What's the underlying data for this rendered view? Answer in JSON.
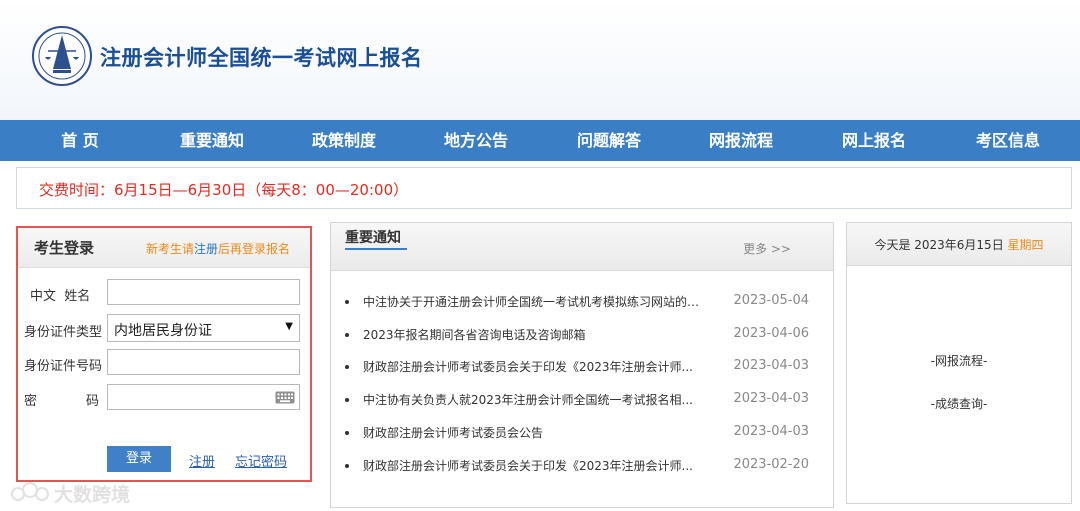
{
  "header": {
    "site_title": "注册会计师全国统一考试网上报名"
  },
  "nav": {
    "items": [
      "首 页",
      "重要通知",
      "政策制度",
      "地方公告",
      "问题解答",
      "网报流程",
      "网上报名",
      "考区信息"
    ]
  },
  "notice": {
    "text": "交费时间：6月15日—6月30日（每天8：00—20:00）"
  },
  "login": {
    "title": "考生登录",
    "hint_before": "新考生请",
    "hint_link": "注册",
    "hint_after": "后再登录报名",
    "name_label": "中文  姓名",
    "id_type_label": "身份证件类型",
    "id_type_value": "内地居民身份证",
    "id_number_label": "身份证件号码",
    "password_label_a": "密",
    "password_label_b": "码",
    "name_value": "",
    "id_number_value": "",
    "password_value": "",
    "login_button": "登录",
    "register_link": "注册",
    "forgot_link": "忘记密码"
  },
  "news": {
    "title": "重要通知",
    "more": "更多 >>",
    "items": [
      {
        "text": "中注协关于开通注册会计师全国统一考试机考模拟练习网站的公...",
        "date": "2023-05-04"
      },
      {
        "text": "2023年报名期间各省咨询电话及咨询邮箱",
        "date": "2023-04-06"
      },
      {
        "text": "财政部注册会计师考试委员会关于印发《2023年注册会计师...",
        "date": "2023-04-03"
      },
      {
        "text": "中注协有关负责人就2023年注册会计师全国统一考试报名相...",
        "date": "2023-04-03"
      },
      {
        "text": "财政部注册会计师考试委员会公告",
        "date": "2023-04-03"
      },
      {
        "text": "财政部注册会计师考试委员会关于印发《2023年注册会计师...",
        "date": "2023-02-20"
      }
    ]
  },
  "side": {
    "today_prefix": "今天是 2023年6月15日",
    "weekday": "星期四",
    "links": [
      "-网报流程-",
      "-成绩查询-"
    ]
  },
  "watermark": {
    "text": "大数跨境"
  },
  "colors": {
    "nav_bg": "#3a7ec6",
    "title_blue": "#1a4f96",
    "notice_red": "#e02b20",
    "hint_orange": "#ef8a1a",
    "highlight_border": "#e15653"
  }
}
